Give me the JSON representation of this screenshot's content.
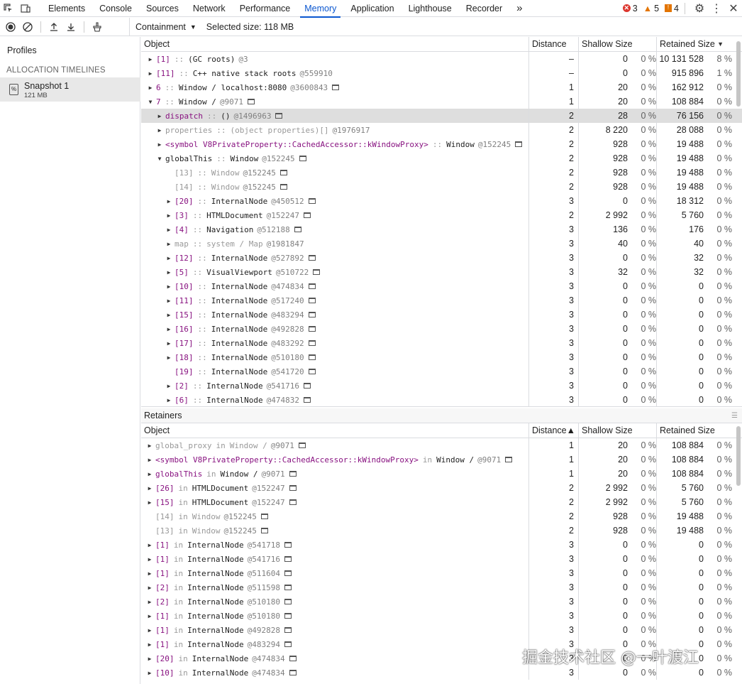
{
  "tabs": [
    "Elements",
    "Console",
    "Sources",
    "Network",
    "Performance",
    "Memory",
    "Application",
    "Lighthouse",
    "Recorder"
  ],
  "active_tab": "Memory",
  "more_tabs": "»",
  "badges": {
    "errors": "3",
    "warnings": "5",
    "issues": "4"
  },
  "toolbar": {
    "view": "Containment",
    "selected_size": "Selected size: 118 MB"
  },
  "sidebar": {
    "profiles_label": "Profiles",
    "section": "ALLOCATION TIMELINES",
    "snapshot_name": "Snapshot 1",
    "snapshot_size": "121 MB"
  },
  "columns": {
    "object": "Object",
    "distance": "Distance",
    "shallow": "Shallow Size",
    "retained": "Retained Size",
    "sort_arrow": "▼"
  },
  "retainers_label": "Retainers",
  "retainer_columns": {
    "object": "Object",
    "distance": "Distance▲",
    "shallow": "Shallow Size",
    "retained": "Retained Size"
  },
  "rows": [
    {
      "i": 0,
      "tri": "▶",
      "name": "[1]",
      "sep": "::",
      "type": "(GC roots)",
      "id": "@3",
      "d": "–",
      "s": "0",
      "sp": "0 %",
      "r": "10 131 528",
      "rp": "8 %"
    },
    {
      "i": 0,
      "tri": "▶",
      "name": "[11]",
      "sep": "::",
      "type": "C++ native stack roots",
      "id": "@559910",
      "d": "–",
      "s": "0",
      "sp": "0 %",
      "r": "915 896",
      "rp": "1 %"
    },
    {
      "i": 0,
      "tri": "▶",
      "name": "6",
      "sep": "::",
      "type": "Window / localhost:8080",
      "id": "@3600843",
      "d": "1",
      "s": "20",
      "sp": "0 %",
      "r": "162 912",
      "rp": "0 %",
      "win": true
    },
    {
      "i": 0,
      "tri": "▼",
      "name": "7",
      "sep": "::",
      "type": "Window /",
      "id": "@9071",
      "d": "1",
      "s": "20",
      "sp": "0 %",
      "r": "108 884",
      "rp": "0 %",
      "win": true
    },
    {
      "i": 1,
      "tri": "▶",
      "name": "dispatch",
      "sep": "::",
      "type": "()",
      "id": "@1496963",
      "d": "2",
      "s": "28",
      "sp": "0 %",
      "r": "76 156",
      "rp": "0 %",
      "win": true,
      "sel": true
    },
    {
      "i": 1,
      "tri": "▶",
      "name": "properties",
      "sep": "::",
      "type": "(object properties)[]",
      "id": "@1976917",
      "d": "2",
      "s": "8 220",
      "sp": "0 %",
      "r": "28 088",
      "rp": "0 %",
      "g": true
    },
    {
      "i": 1,
      "tri": "▶",
      "name": "<symbol V8PrivateProperty::CachedAccessor::kWindowProxy>",
      "sep": "::",
      "type": "Window",
      "id": "@152245",
      "d": "2",
      "s": "928",
      "sp": "0 %",
      "r": "19 488",
      "rp": "0 %",
      "win": true
    },
    {
      "i": 1,
      "tri": "▼",
      "name": "globalThis",
      "sep": "::",
      "type": "Window",
      "id": "@152245",
      "d": "2",
      "s": "928",
      "sp": "0 %",
      "r": "19 488",
      "rp": "0 %",
      "win": true,
      "plain": true
    },
    {
      "i": 2,
      "tri": "",
      "name": "[13]",
      "sep": "::",
      "type": "Window",
      "id": "@152245",
      "d": "2",
      "s": "928",
      "sp": "0 %",
      "r": "19 488",
      "rp": "0 %",
      "win": true,
      "g": true
    },
    {
      "i": 2,
      "tri": "",
      "name": "[14]",
      "sep": "::",
      "type": "Window",
      "id": "@152245",
      "d": "2",
      "s": "928",
      "sp": "0 %",
      "r": "19 488",
      "rp": "0 %",
      "win": true,
      "g": true
    },
    {
      "i": 2,
      "tri": "▶",
      "name": "[20]",
      "sep": "::",
      "type": "InternalNode",
      "id": "@450512",
      "d": "3",
      "s": "0",
      "sp": "0 %",
      "r": "18 312",
      "rp": "0 %",
      "win": true
    },
    {
      "i": 2,
      "tri": "▶",
      "name": "[3]",
      "sep": "::",
      "type": "HTMLDocument",
      "id": "@152247",
      "d": "2",
      "s": "2 992",
      "sp": "0 %",
      "r": "5 760",
      "rp": "0 %",
      "win": true
    },
    {
      "i": 2,
      "tri": "▶",
      "name": "[4]",
      "sep": "::",
      "type": "Navigation",
      "id": "@512188",
      "d": "3",
      "s": "136",
      "sp": "0 %",
      "r": "176",
      "rp": "0 %",
      "win": true
    },
    {
      "i": 2,
      "tri": "▶",
      "name": "map",
      "sep": "::",
      "type": "system / Map",
      "id": "@1981847",
      "d": "3",
      "s": "40",
      "sp": "0 %",
      "r": "40",
      "rp": "0 %",
      "g": true
    },
    {
      "i": 2,
      "tri": "▶",
      "name": "[12]",
      "sep": "::",
      "type": "InternalNode",
      "id": "@527892",
      "d": "3",
      "s": "0",
      "sp": "0 %",
      "r": "32",
      "rp": "0 %",
      "win": true
    },
    {
      "i": 2,
      "tri": "▶",
      "name": "[5]",
      "sep": "::",
      "type": "VisualViewport",
      "id": "@510722",
      "d": "3",
      "s": "32",
      "sp": "0 %",
      "r": "32",
      "rp": "0 %",
      "win": true
    },
    {
      "i": 2,
      "tri": "▶",
      "name": "[10]",
      "sep": "::",
      "type": "InternalNode",
      "id": "@474834",
      "d": "3",
      "s": "0",
      "sp": "0 %",
      "r": "0",
      "rp": "0 %",
      "win": true
    },
    {
      "i": 2,
      "tri": "▶",
      "name": "[11]",
      "sep": "::",
      "type": "InternalNode",
      "id": "@517240",
      "d": "3",
      "s": "0",
      "sp": "0 %",
      "r": "0",
      "rp": "0 %",
      "win": true
    },
    {
      "i": 2,
      "tri": "▶",
      "name": "[15]",
      "sep": "::",
      "type": "InternalNode",
      "id": "@483294",
      "d": "3",
      "s": "0",
      "sp": "0 %",
      "r": "0",
      "rp": "0 %",
      "win": true
    },
    {
      "i": 2,
      "tri": "▶",
      "name": "[16]",
      "sep": "::",
      "type": "InternalNode",
      "id": "@492828",
      "d": "3",
      "s": "0",
      "sp": "0 %",
      "r": "0",
      "rp": "0 %",
      "win": true
    },
    {
      "i": 2,
      "tri": "▶",
      "name": "[17]",
      "sep": "::",
      "type": "InternalNode",
      "id": "@483292",
      "d": "3",
      "s": "0",
      "sp": "0 %",
      "r": "0",
      "rp": "0 %",
      "win": true
    },
    {
      "i": 2,
      "tri": "▶",
      "name": "[18]",
      "sep": "::",
      "type": "InternalNode",
      "id": "@510180",
      "d": "3",
      "s": "0",
      "sp": "0 %",
      "r": "0",
      "rp": "0 %",
      "win": true
    },
    {
      "i": 2,
      "tri": "",
      "name": "[19]",
      "sep": "::",
      "type": "InternalNode",
      "id": "@541720",
      "d": "3",
      "s": "0",
      "sp": "0 %",
      "r": "0",
      "rp": "0 %",
      "win": true
    },
    {
      "i": 2,
      "tri": "▶",
      "name": "[2]",
      "sep": "::",
      "type": "InternalNode",
      "id": "@541716",
      "d": "3",
      "s": "0",
      "sp": "0 %",
      "r": "0",
      "rp": "0 %",
      "win": true
    },
    {
      "i": 2,
      "tri": "▶",
      "name": "[6]",
      "sep": "::",
      "type": "InternalNode",
      "id": "@474832",
      "d": "3",
      "s": "0",
      "sp": "0 %",
      "r": "0",
      "rp": "0 %",
      "win": true
    }
  ],
  "retainers": [
    {
      "tri": "▶",
      "name": "global_proxy",
      "sep": "in",
      "type": "Window /",
      "id": "@9071",
      "d": "1",
      "s": "20",
      "sp": "0 %",
      "r": "108 884",
      "rp": "0 %",
      "win": true,
      "g": true
    },
    {
      "tri": "▶",
      "name": "<symbol V8PrivateProperty::CachedAccessor::kWindowProxy>",
      "sep": "in",
      "type": "Window /",
      "id": "@9071",
      "d": "1",
      "s": "20",
      "sp": "0 %",
      "r": "108 884",
      "rp": "0 %",
      "win": true
    },
    {
      "tri": "▶",
      "name": "globalThis",
      "sep": "in",
      "type": "Window /",
      "id": "@9071",
      "d": "1",
      "s": "20",
      "sp": "0 %",
      "r": "108 884",
      "rp": "0 %",
      "win": true
    },
    {
      "tri": "▶",
      "name": "[26]",
      "sep": "in",
      "type": "HTMLDocument",
      "id": "@152247",
      "d": "2",
      "s": "2 992",
      "sp": "0 %",
      "r": "5 760",
      "rp": "0 %",
      "win": true
    },
    {
      "tri": "▶",
      "name": "[15]",
      "sep": "in",
      "type": "HTMLDocument",
      "id": "@152247",
      "d": "2",
      "s": "2 992",
      "sp": "0 %",
      "r": "5 760",
      "rp": "0 %",
      "win": true
    },
    {
      "tri": "",
      "name": "[14]",
      "sep": "in",
      "type": "Window",
      "id": "@152245",
      "d": "2",
      "s": "928",
      "sp": "0 %",
      "r": "19 488",
      "rp": "0 %",
      "win": true,
      "g": true
    },
    {
      "tri": "",
      "name": "[13]",
      "sep": "in",
      "type": "Window",
      "id": "@152245",
      "d": "2",
      "s": "928",
      "sp": "0 %",
      "r": "19 488",
      "rp": "0 %",
      "win": true,
      "g": true
    },
    {
      "tri": "▶",
      "name": "[1]",
      "sep": "in",
      "type": "InternalNode",
      "id": "@541718",
      "d": "3",
      "s": "0",
      "sp": "0 %",
      "r": "0",
      "rp": "0 %",
      "win": true
    },
    {
      "tri": "▶",
      "name": "[1]",
      "sep": "in",
      "type": "InternalNode",
      "id": "@541716",
      "d": "3",
      "s": "0",
      "sp": "0 %",
      "r": "0",
      "rp": "0 %",
      "win": true
    },
    {
      "tri": "▶",
      "name": "[1]",
      "sep": "in",
      "type": "InternalNode",
      "id": "@511604",
      "d": "3",
      "s": "0",
      "sp": "0 %",
      "r": "0",
      "rp": "0 %",
      "win": true
    },
    {
      "tri": "▶",
      "name": "[2]",
      "sep": "in",
      "type": "InternalNode",
      "id": "@511598",
      "d": "3",
      "s": "0",
      "sp": "0 %",
      "r": "0",
      "rp": "0 %",
      "win": true
    },
    {
      "tri": "▶",
      "name": "[2]",
      "sep": "in",
      "type": "InternalNode",
      "id": "@510180",
      "d": "3",
      "s": "0",
      "sp": "0 %",
      "r": "0",
      "rp": "0 %",
      "win": true
    },
    {
      "tri": "▶",
      "name": "[1]",
      "sep": "in",
      "type": "InternalNode",
      "id": "@510180",
      "d": "3",
      "s": "0",
      "sp": "0 %",
      "r": "0",
      "rp": "0 %",
      "win": true
    },
    {
      "tri": "▶",
      "name": "[1]",
      "sep": "in",
      "type": "InternalNode",
      "id": "@492828",
      "d": "3",
      "s": "0",
      "sp": "0 %",
      "r": "0",
      "rp": "0 %",
      "win": true
    },
    {
      "tri": "▶",
      "name": "[1]",
      "sep": "in",
      "type": "InternalNode",
      "id": "@483294",
      "d": "3",
      "s": "0",
      "sp": "0 %",
      "r": "0",
      "rp": "0 %",
      "win": true
    },
    {
      "tri": "▶",
      "name": "[20]",
      "sep": "in",
      "type": "InternalNode",
      "id": "@474834",
      "d": "3",
      "s": "0",
      "sp": "0 %",
      "r": "0",
      "rp": "0 %",
      "win": true
    },
    {
      "tri": "▶",
      "name": "[10]",
      "sep": "in",
      "type": "InternalNode",
      "id": "@474834",
      "d": "3",
      "s": "0",
      "sp": "0 %",
      "r": "0",
      "rp": "0 %",
      "win": true
    }
  ],
  "watermark": "掘金技术社区 @一叶渡江"
}
